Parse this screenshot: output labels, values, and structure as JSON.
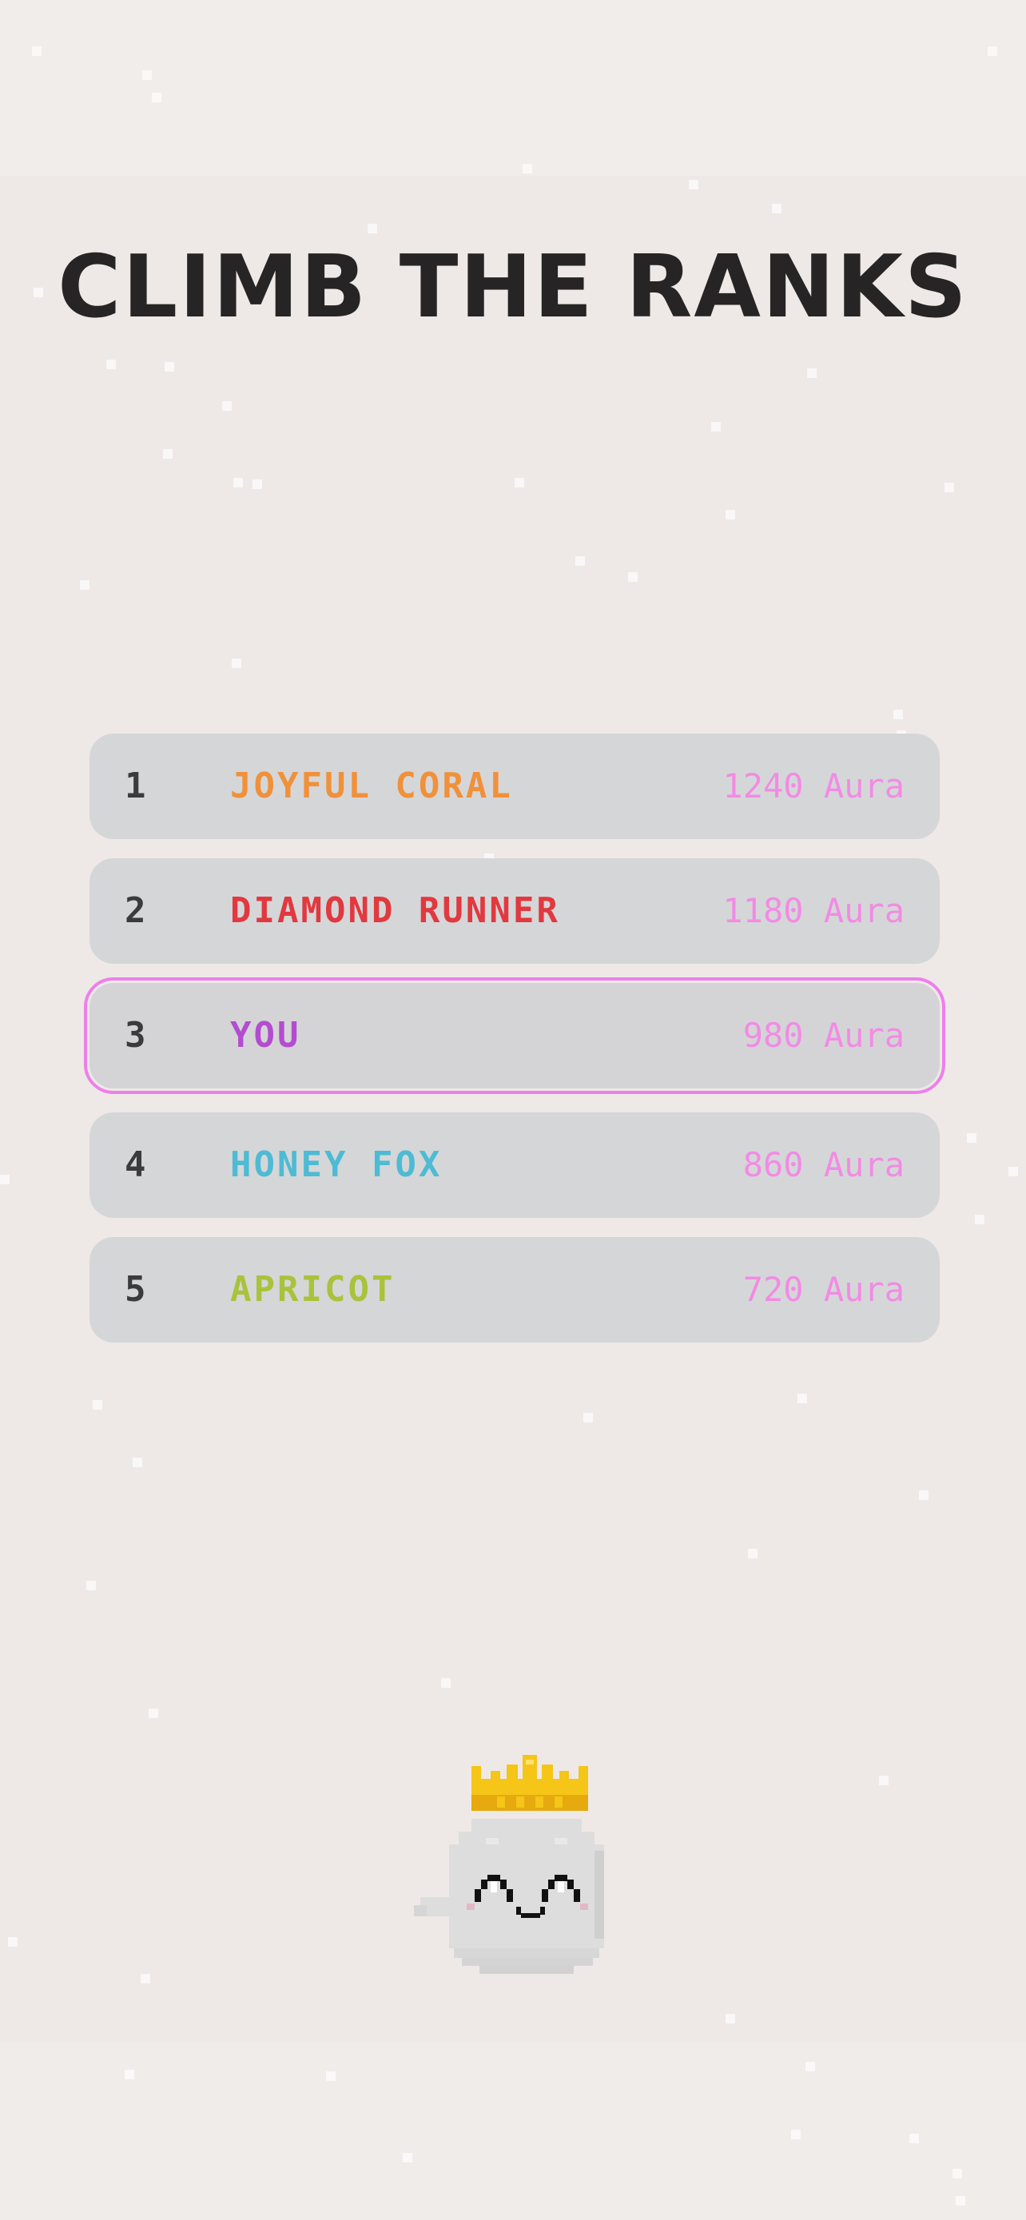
{
  "title": "CLIMB THE RANKS",
  "leaderboard": {
    "rows": [
      {
        "rank": "1",
        "name": "JOYFUL CORAL",
        "score": "1240 Aura",
        "color": "#F0913A",
        "is_you": false
      },
      {
        "rank": "2",
        "name": "DIAMOND RUNNER",
        "score": "1180 Aura",
        "color": "#E0393F",
        "is_you": false
      },
      {
        "rank": "3",
        "name": "YOU",
        "score": "980 Aura",
        "color": "#B44CD0",
        "is_you": true
      },
      {
        "rank": "4",
        "name": "HONEY FOX",
        "score": "860 Aura",
        "color": "#4DBBD3",
        "is_you": false
      },
      {
        "rank": "5",
        "name": "APRICOT",
        "score": "720 Aura",
        "color": "#A8C33B",
        "is_you": false
      }
    ],
    "score_color": "#F28BE4",
    "highlight_color": "#EE7FEA"
  },
  "mascot": {
    "icon": "crowned-ghost-icon"
  },
  "colors": {
    "background": "#EEE9E7",
    "title": "#262424",
    "row_background": "#D5D6D8",
    "crown": "#F5C518"
  }
}
